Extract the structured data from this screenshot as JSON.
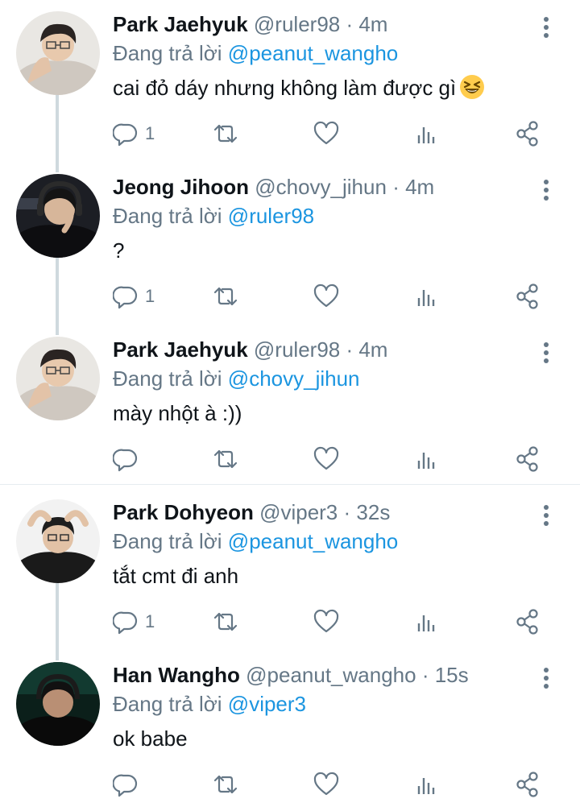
{
  "tweets": [
    {
      "name": "Park Jaehyuk",
      "handle": "@ruler98",
      "time": "· 4m",
      "reply_label": "Đang trả lời",
      "reply_to": "@peanut_wangho",
      "text": "cai đỏ dáy nhưng không làm được gì",
      "emoji": "grinning-squinting-face",
      "reply_count": "1",
      "avatar": "avatar-ruler98"
    },
    {
      "name": "Jeong Jihoon",
      "handle": "@chovy_jihun",
      "time": "· 4m",
      "reply_label": "Đang trả lời",
      "reply_to": "@ruler98",
      "text": "?",
      "reply_count": "1",
      "avatar": "avatar-chovy_jihun"
    },
    {
      "name": "Park Jaehyuk",
      "handle": "@ruler98",
      "time": "· 4m",
      "reply_label": "Đang trả lời",
      "reply_to": "@chovy_jihun",
      "text": "mày nhột à :))",
      "reply_count": "",
      "avatar": "avatar-ruler98"
    },
    {
      "name": "Park Dohyeon",
      "handle": "@viper3",
      "time": "· 32s",
      "reply_label": "Đang trả lời",
      "reply_to": "@peanut_wangho",
      "text": "tắt cmt đi anh",
      "reply_count": "1",
      "avatar": "avatar-viper3"
    },
    {
      "name": "Han Wangho",
      "handle": "@peanut_wangho",
      "time": "· 15s",
      "reply_label": "Đang trả lời",
      "reply_to": "@viper3",
      "text": "ok babe",
      "reply_count": "",
      "avatar": "avatar-peanut_wangho"
    }
  ],
  "icons": [
    "reply-icon",
    "retweet-icon",
    "like-icon",
    "stats-icon",
    "share-icon",
    "more-options-icon"
  ],
  "colors": {
    "mention": "#1b95e0",
    "secondary_text": "#657786",
    "thread_line": "#cfd9de",
    "separator": "#e6ecf0"
  }
}
